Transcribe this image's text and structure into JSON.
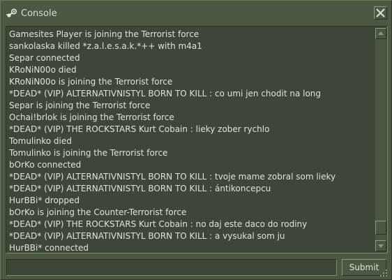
{
  "window": {
    "title": "Console",
    "icon": "steam-logo-icon",
    "close_icon": "close-x-icon"
  },
  "log": {
    "lines": [
      "Gamesites Player is joining the Terrorist force",
      "sankolaska killed *z.a.l.e.s.a.k.*++ with m4a1",
      "Separ connected",
      "KRoNiN00o died",
      "KRoNiN00o is joining the Terrorist force",
      "*DEAD* (VIP) ALTERNATIVNISTYL BORN TO KILL : co umi jen chodit na long",
      "Separ is joining the Terrorist force",
      "Ochai!brlok is joining the Terrorist force",
      "*DEAD* (VIP) THE ROCKSTARS Kurt Cobain : lieky zober rychlo",
      "Tomulinko died",
      "Tomulinko is joining the Terrorist force",
      "bOrKo connected",
      "*DEAD* (VIP) ALTERNATIVNISTYL BORN TO KILL : tvoje mame zobral som lieky",
      "*DEAD* (VIP) ALTERNATIVNISTYL BORN TO KILL : ántikoncepcu",
      "HurBBi* dropped",
      "bOrKo is joining the Counter-Terrorist force",
      "*DEAD* (VIP) THE ROCKSTARS Kurt Cobain : no daj este daco do rodiny",
      "*DEAD* (VIP) ALTERNATIVNISTYL BORN TO KILL : a vysukal som ju",
      "HurBBi* connected"
    ]
  },
  "scrollbar": {
    "up_icon": "scroll-up-arrow-icon",
    "down_icon": "scroll-down-arrow-icon",
    "position": 0.97
  },
  "command": {
    "value": "",
    "submit_label": "Submit"
  },
  "colors": {
    "background": "#4c5844",
    "panel": "#3e4637",
    "text": "#dfe4d9"
  }
}
